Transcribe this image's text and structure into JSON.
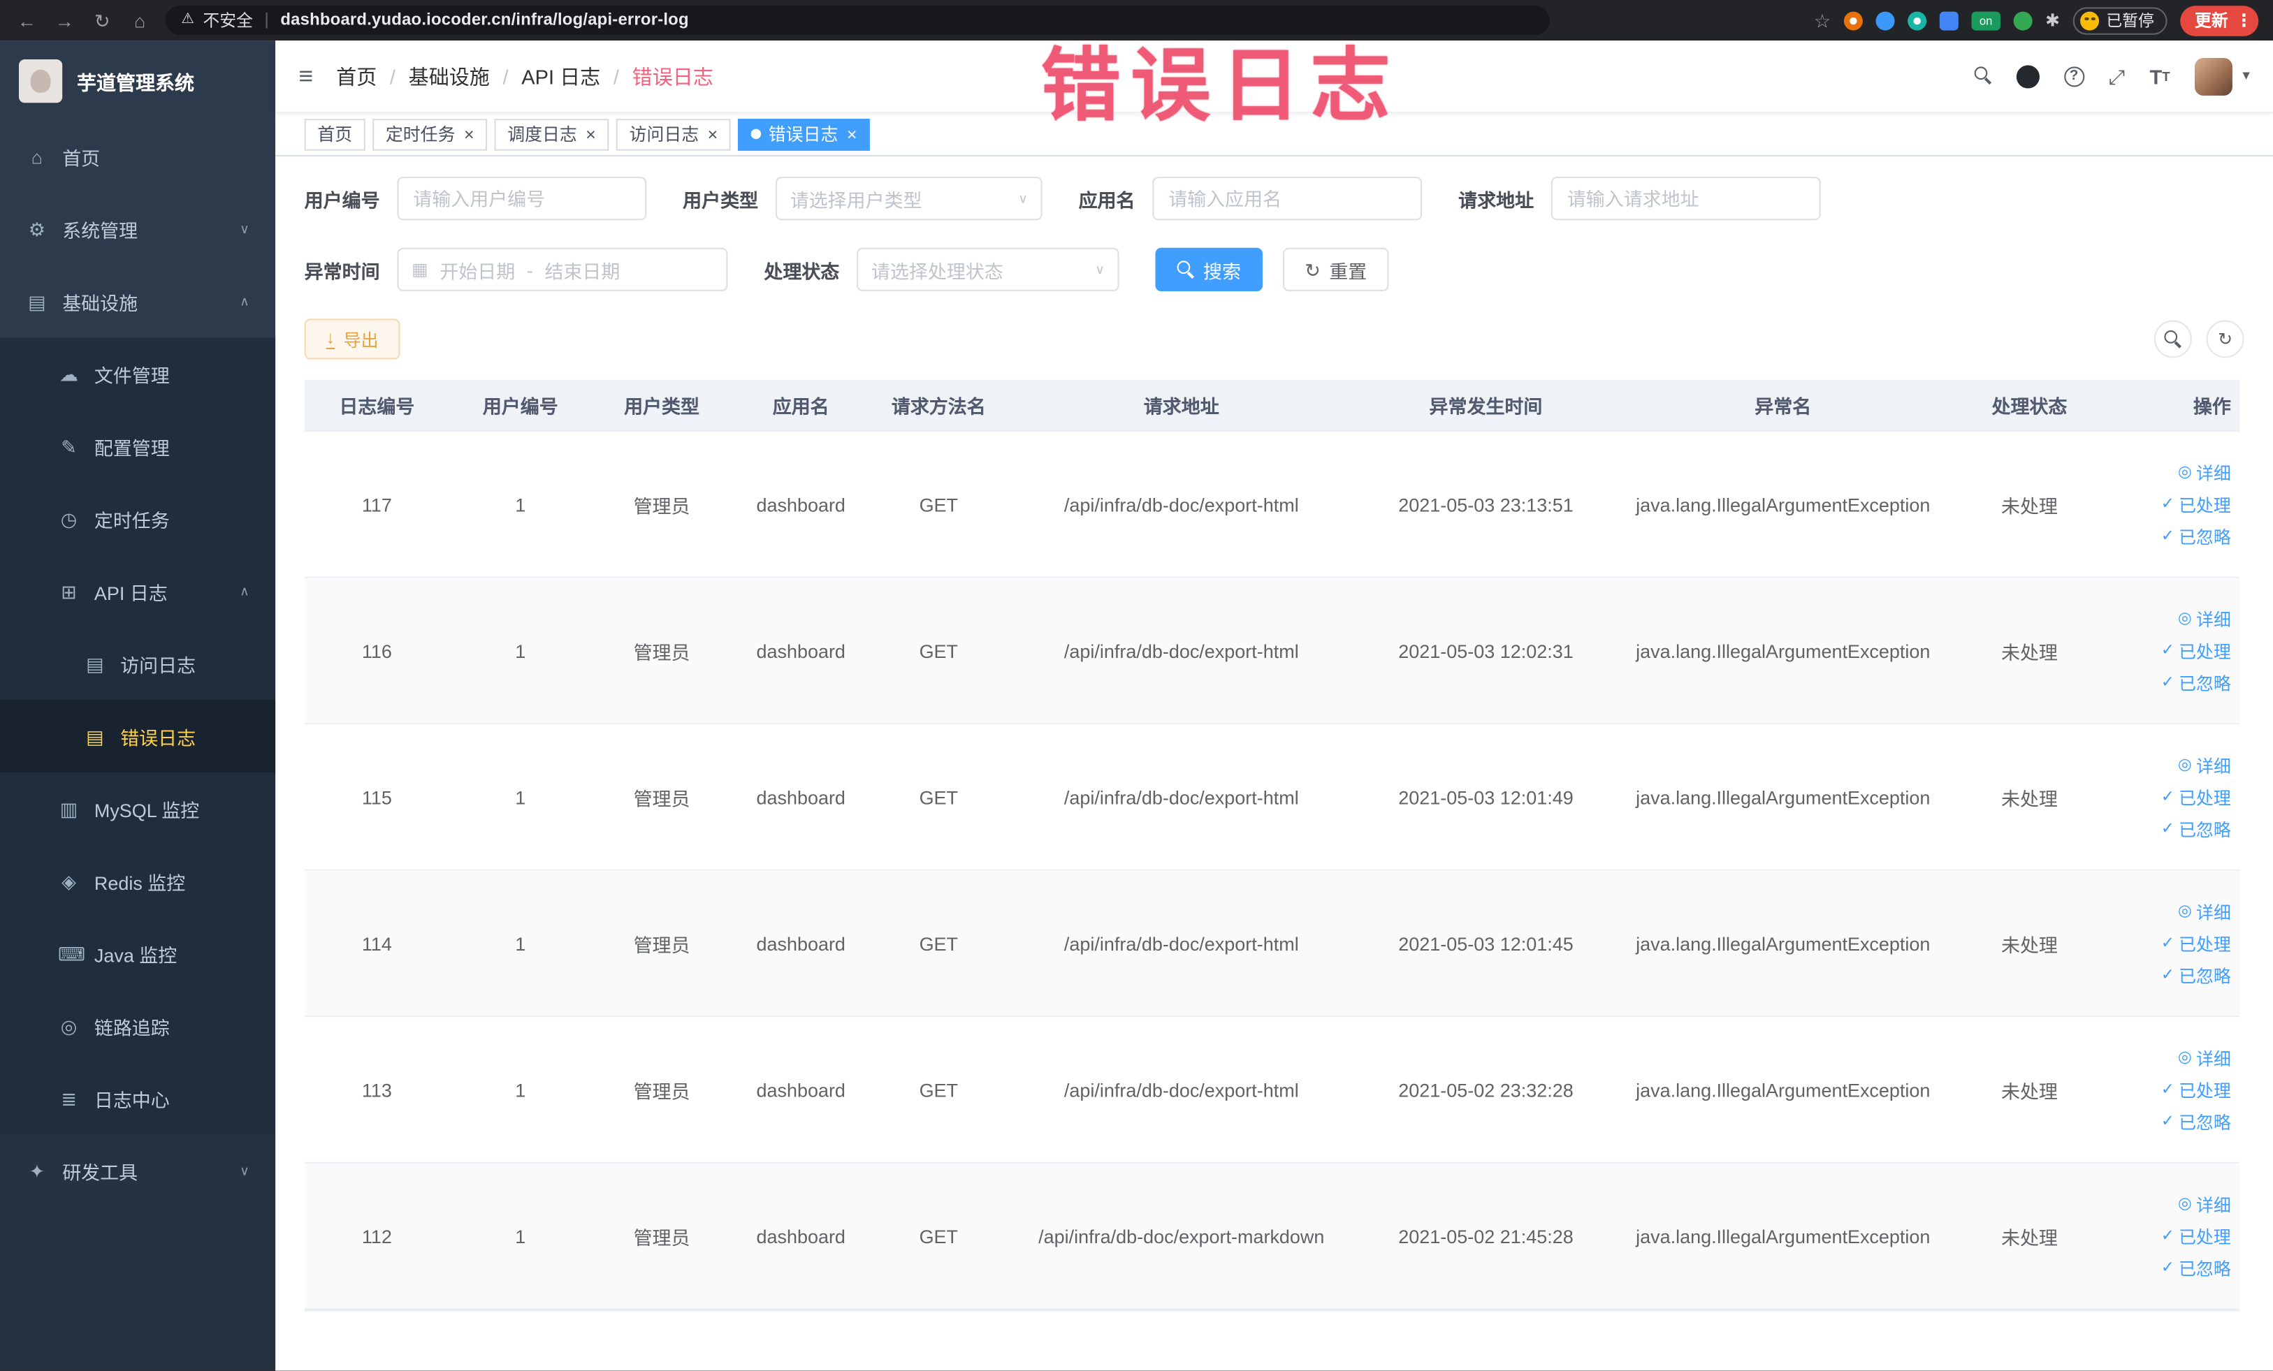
{
  "overlay": {
    "text": "错误日志"
  },
  "colors": {
    "accent": "#409eff",
    "warning": "#e6a23c",
    "annotation": "#ef5a77",
    "menu_active": "#ffd04b",
    "update_red": "#e4483f"
  },
  "browser": {
    "warning": "不安全",
    "url": "dashboard.yudao.iocoder.cn/infra/log/api-error-log",
    "on_badge": "on",
    "paused": "已暂停",
    "update": "更新"
  },
  "sidebar": {
    "title": "芋道管理系统",
    "home": "首页",
    "system": "系统管理",
    "infra": "基础设施",
    "file": "文件管理",
    "config": "配置管理",
    "cron": "定时任务",
    "api_log": "API 日志",
    "access_log": "访问日志",
    "error_log": "错误日志",
    "mysql": "MySQL 监控",
    "redis": "Redis 监控",
    "java": "Java 监控",
    "trace": "链路追踪",
    "log_center": "日志中心",
    "devtools": "研发工具"
  },
  "header": {
    "breadcrumb": [
      "首页",
      "基础设施",
      "API 日志",
      "错误日志"
    ]
  },
  "tabs": [
    {
      "label": "首页"
    },
    {
      "label": "定时任务"
    },
    {
      "label": "调度日志"
    },
    {
      "label": "访问日志"
    },
    {
      "label": "错误日志"
    }
  ],
  "filters": {
    "user_id": {
      "label": "用户编号",
      "placeholder": "请输入用户编号"
    },
    "user_type": {
      "label": "用户类型",
      "placeholder": "请选择用户类型"
    },
    "app_name": {
      "label": "应用名",
      "placeholder": "请输入应用名"
    },
    "request_url": {
      "label": "请求地址",
      "placeholder": "请输入请求地址"
    },
    "exception_time": {
      "label": "异常时间",
      "start_placeholder": "开始日期",
      "separator": "-",
      "end_placeholder": "结束日期"
    },
    "process_status": {
      "label": "处理状态",
      "placeholder": "请选择处理状态"
    },
    "search_label": "搜索",
    "reset_label": "重置"
  },
  "toolbar": {
    "export": "导出"
  },
  "table": {
    "columns": [
      "日志编号",
      "用户编号",
      "用户类型",
      "应用名",
      "请求方法名",
      "请求地址",
      "异常发生时间",
      "异常名",
      "处理状态",
      "操作"
    ],
    "actions": {
      "detail": "详细",
      "processed": "已处理",
      "ignored": "已忽略"
    },
    "rows": [
      {
        "id": "117",
        "user_id": "1",
        "user_type": "管理员",
        "app": "dashboard",
        "method": "GET",
        "url": "/api/infra/db-doc/export-html",
        "time": "2021-05-03 23:13:51",
        "exception": "java.lang.IllegalArgumentException",
        "status": "未处理"
      },
      {
        "id": "116",
        "user_id": "1",
        "user_type": "管理员",
        "app": "dashboard",
        "method": "GET",
        "url": "/api/infra/db-doc/export-html",
        "time": "2021-05-03 12:02:31",
        "exception": "java.lang.IllegalArgumentException",
        "status": "未处理"
      },
      {
        "id": "115",
        "user_id": "1",
        "user_type": "管理员",
        "app": "dashboard",
        "method": "GET",
        "url": "/api/infra/db-doc/export-html",
        "time": "2021-05-03 12:01:49",
        "exception": "java.lang.IllegalArgumentException",
        "status": "未处理"
      },
      {
        "id": "114",
        "user_id": "1",
        "user_type": "管理员",
        "app": "dashboard",
        "method": "GET",
        "url": "/api/infra/db-doc/export-html",
        "time": "2021-05-03 12:01:45",
        "exception": "java.lang.IllegalArgumentException",
        "status": "未处理"
      },
      {
        "id": "113",
        "user_id": "1",
        "user_type": "管理员",
        "app": "dashboard",
        "method": "GET",
        "url": "/api/infra/db-doc/export-html",
        "time": "2021-05-02 23:32:28",
        "exception": "java.lang.IllegalArgumentException",
        "status": "未处理"
      },
      {
        "id": "112",
        "user_id": "1",
        "user_type": "管理员",
        "app": "dashboard",
        "method": "GET",
        "url": "/api/infra/db-doc/export-markdown",
        "time": "2021-05-02 21:45:28",
        "exception": "java.lang.IllegalArgumentException",
        "status": "未处理"
      }
    ]
  }
}
